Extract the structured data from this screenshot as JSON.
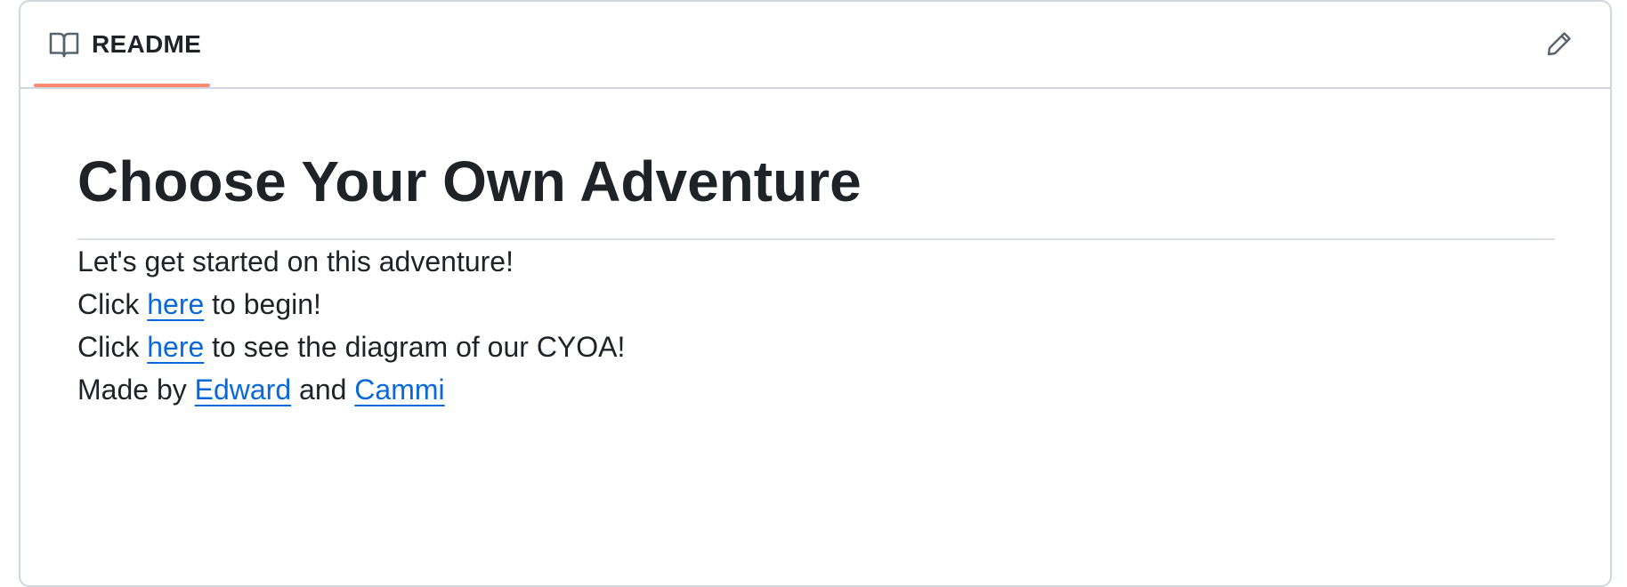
{
  "readme": {
    "tab_label": "README",
    "tab_icon": "book-icon",
    "edit_icon": "pencil-icon",
    "accent_color": "#fd8c73",
    "link_color": "#0969da"
  },
  "content": {
    "title": "Choose Your Own Adventure",
    "intro": "Let's get started on this adventure!",
    "line2": {
      "prefix": "Click ",
      "link": "here",
      "suffix": " to begin!"
    },
    "line3": {
      "prefix": "Click ",
      "link": "here",
      "suffix": " to see the diagram of our CYOA!"
    },
    "credits": {
      "prefix": "Made by ",
      "author1": "Edward",
      "connector": " and ",
      "author2": "Cammi"
    }
  }
}
